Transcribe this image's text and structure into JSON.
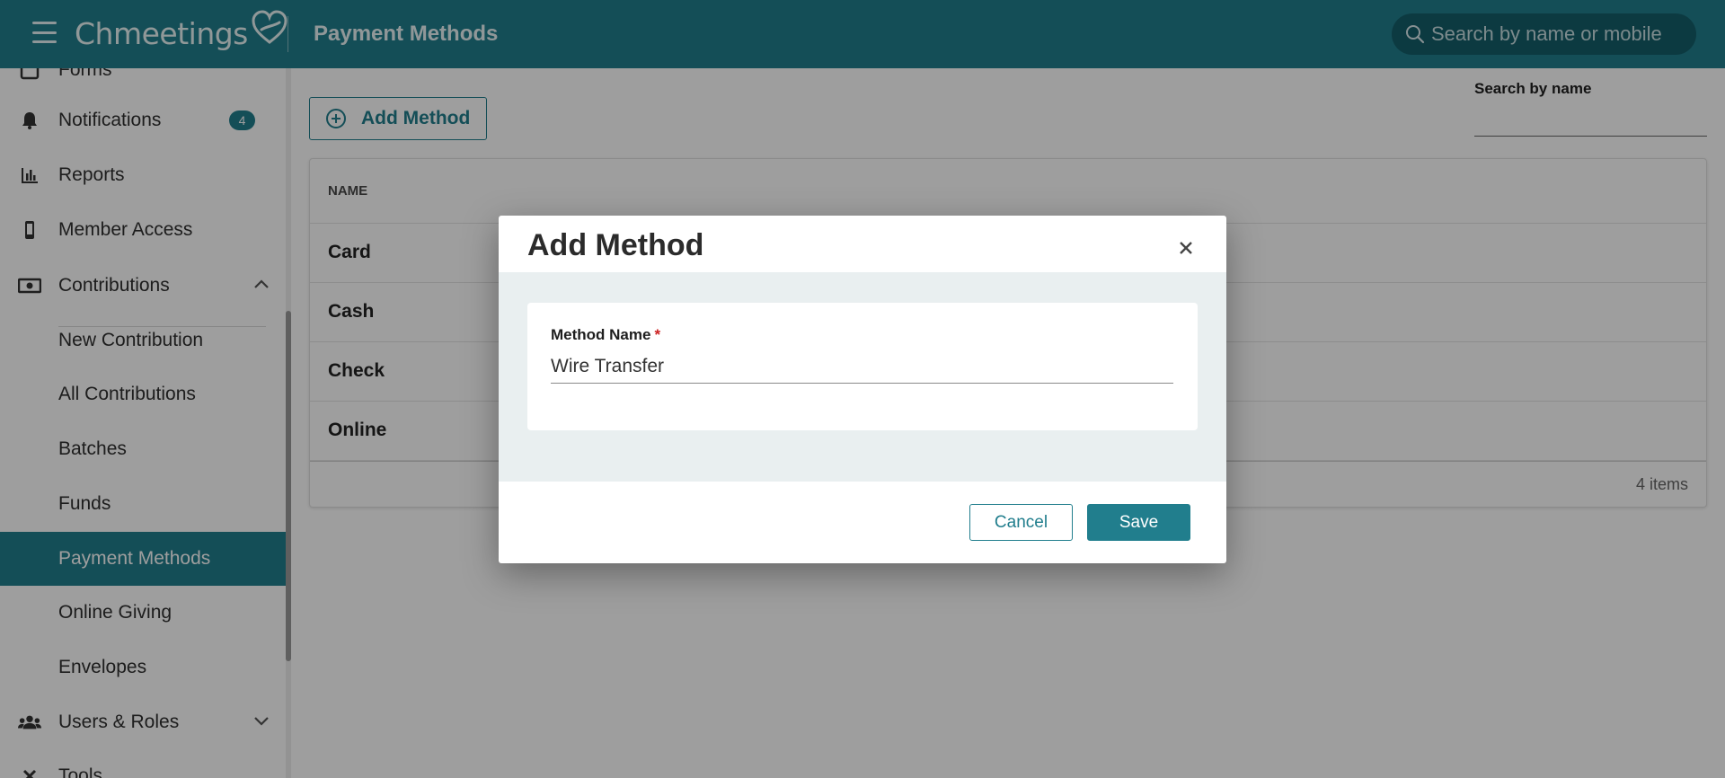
{
  "header": {
    "logo_text": "Chmeetings",
    "page_title": "Payment Methods",
    "search_placeholder": "Search by name or mobile"
  },
  "sidebar": {
    "items": [
      {
        "label": "Forms",
        "icon": "forms-icon"
      },
      {
        "label": "Notifications",
        "icon": "bell-icon",
        "badge": "4"
      },
      {
        "label": "Reports",
        "icon": "bar-chart-icon"
      },
      {
        "label": "Member Access",
        "icon": "mobile-phone-icon"
      },
      {
        "label": "Contributions",
        "icon": "money-icon",
        "expanded": true
      },
      {
        "label": "New Contribution"
      },
      {
        "label": "All Contributions"
      },
      {
        "label": "Batches"
      },
      {
        "label": "Funds"
      },
      {
        "label": "Payment Methods",
        "active": true
      },
      {
        "label": "Online Giving"
      },
      {
        "label": "Envelopes"
      },
      {
        "label": "Users & Roles",
        "icon": "users-icon",
        "expanded": false
      },
      {
        "label": "Tools",
        "icon": "tools-icon"
      }
    ]
  },
  "main": {
    "add_button_label": "Add Method",
    "search_label": "Search by name",
    "grid": {
      "column_header": "NAME",
      "rows": [
        "Card",
        "Cash",
        "Check",
        "Online"
      ],
      "footer_count": "4 items"
    }
  },
  "dialog": {
    "title": "Add Method",
    "field_label": "Method Name",
    "required_marker": "*",
    "field_value": "Wire Transfer",
    "cancel_label": "Cancel",
    "save_label": "Save"
  },
  "colors": {
    "brand": "#217e8d",
    "brand_dark": "#145e6a",
    "required": "#cc2020"
  }
}
